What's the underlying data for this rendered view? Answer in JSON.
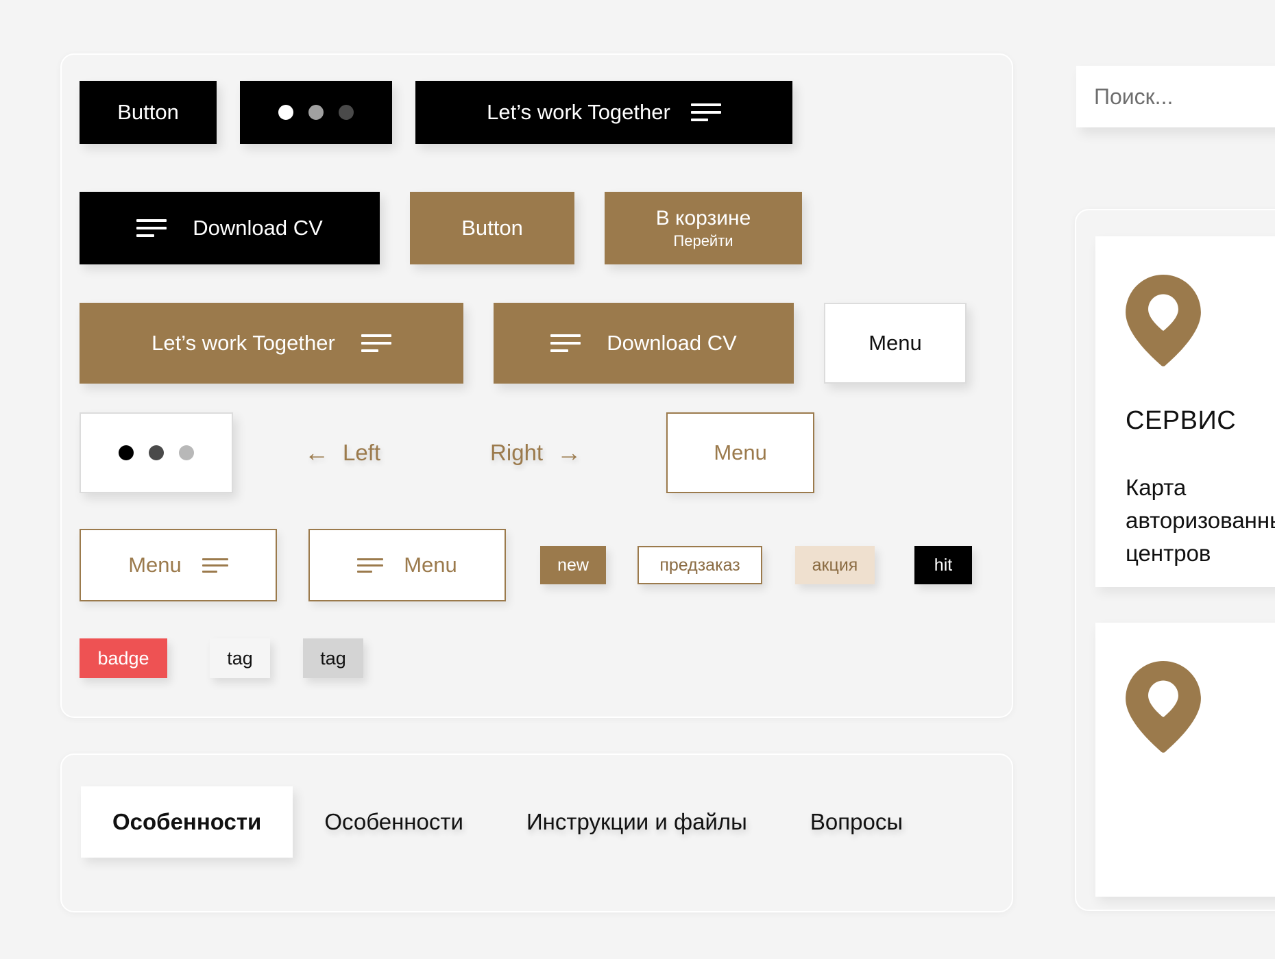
{
  "background_color": "#f4f4f4",
  "accent_color": "#9b7a4c",
  "components_panel": {
    "row1": {
      "button_primary": {
        "label": "Button"
      },
      "dots_dark": {
        "icon": "three-dots-indicator",
        "colors": [
          "#ffffff",
          "#a0a0a0",
          "#4a4a4a"
        ]
      },
      "cta_dark": {
        "label": "Let’s work Together",
        "icon": "hamburger-icon"
      }
    },
    "row2": {
      "download_dark": {
        "label": "Download CV",
        "icon": "hamburger-icon"
      },
      "button_gold": {
        "label": "Button"
      },
      "cart_gold": {
        "line1": "В корзине",
        "line2": "Перейти"
      }
    },
    "row3": {
      "cta_gold": {
        "label": "Let’s work Together",
        "icon": "hamburger-icon"
      },
      "download_gold": {
        "label": "Download CV",
        "icon": "hamburger-icon"
      },
      "menu_white": {
        "label": "Menu"
      }
    },
    "row4": {
      "dots_light": {
        "icon": "three-dots-indicator",
        "colors": [
          "#000000",
          "#4a4a4a",
          "#b8b8b8"
        ]
      },
      "nav_left": {
        "label": "Left",
        "glyph": "←"
      },
      "nav_right": {
        "label": "Right",
        "glyph": "→"
      },
      "menu_outline": {
        "label": "Menu"
      }
    },
    "row5": {
      "menu_icon_right": {
        "label": "Menu",
        "icon": "hamburger-icon"
      },
      "menu_icon_left": {
        "label": "Menu",
        "icon": "hamburger-icon"
      },
      "tag_new": {
        "label": "new"
      },
      "tag_preorder": {
        "label": "предзаказ"
      },
      "tag_sale": {
        "label": "акция"
      },
      "tag_hit": {
        "label": "hit"
      }
    },
    "row6": {
      "badge": {
        "label": "badge"
      },
      "tag_light": {
        "label": "tag"
      },
      "tag_grey": {
        "label": "tag"
      }
    }
  },
  "tabs_panel": {
    "tabs": [
      {
        "label": "Особенности",
        "active": true
      },
      {
        "label": "Особенности",
        "active": false
      },
      {
        "label": "Инструкции и файлы",
        "active": false
      },
      {
        "label": "Вопросы",
        "active": false
      }
    ]
  },
  "search": {
    "placeholder": "Поиск...",
    "value": ""
  },
  "map_panel": {
    "card1": {
      "icon": "map-pin-icon",
      "title": "СЕРВИС",
      "description": "Карта авторизованных центров"
    },
    "card2": {
      "icon": "map-pin-icon"
    }
  }
}
